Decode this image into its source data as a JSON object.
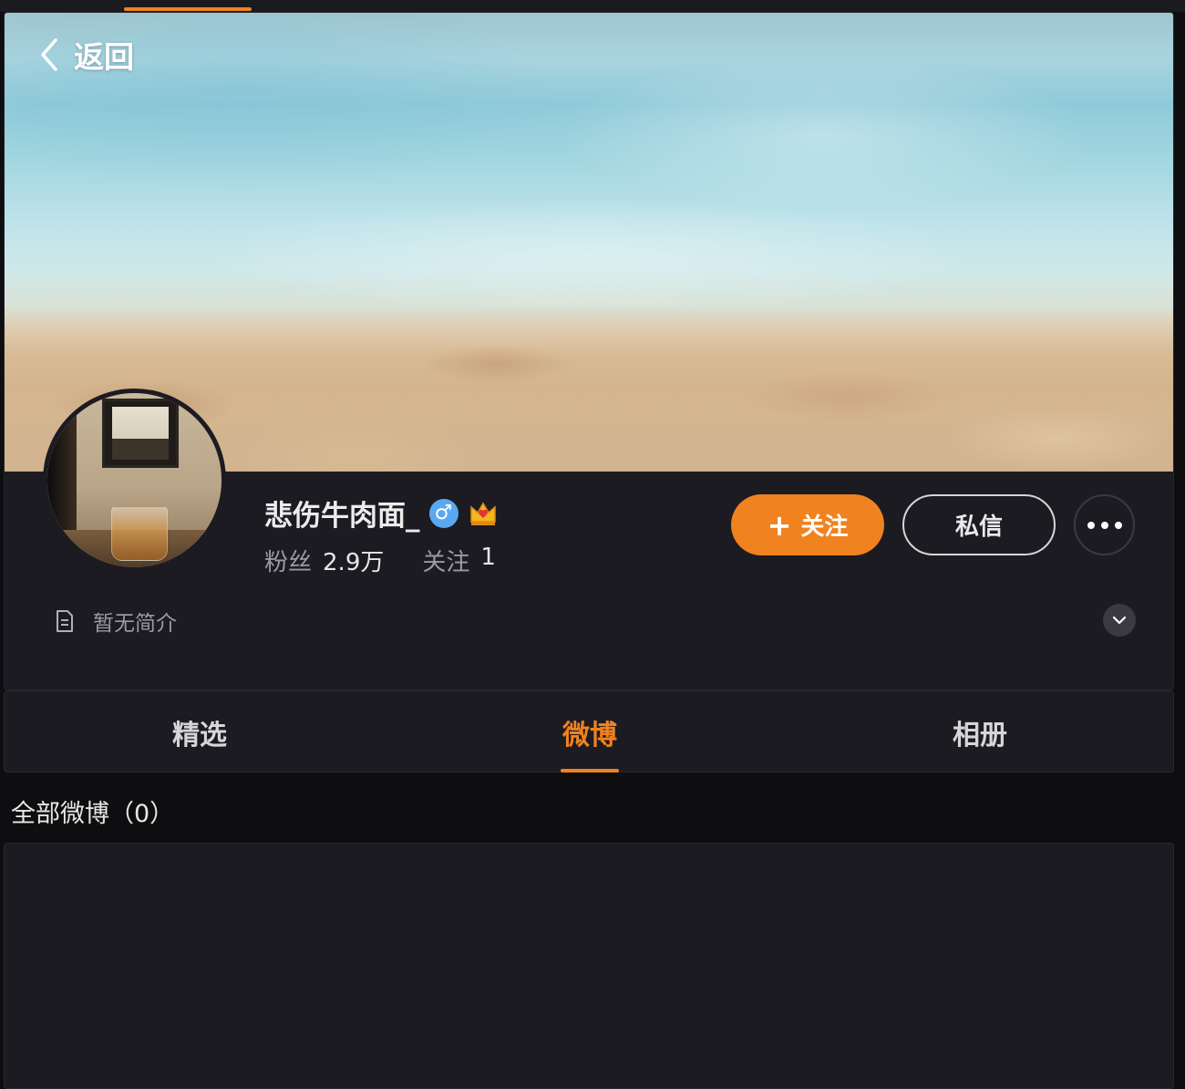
{
  "header": {
    "back_label": "返回"
  },
  "profile": {
    "name": "悲伤牛肉面_",
    "gender_badge": "♂",
    "crown_icon": "crown-icon",
    "followers_label": "粉丝",
    "followers_value": "2.9万",
    "following_label": "关注",
    "following_value": "1",
    "bio": "暂无简介"
  },
  "actions": {
    "follow_plus": "+",
    "follow_label": "关注",
    "message_label": "私信"
  },
  "tabs": [
    {
      "label": "精选",
      "active": false
    },
    {
      "label": "微博",
      "active": true
    },
    {
      "label": "相册",
      "active": false
    }
  ],
  "feed": {
    "title": "全部微博（0）"
  },
  "colors": {
    "accent": "#f0821f",
    "background": "#0e0e10",
    "card": "#1c1b22",
    "male_badge": "#5aa9f0"
  }
}
